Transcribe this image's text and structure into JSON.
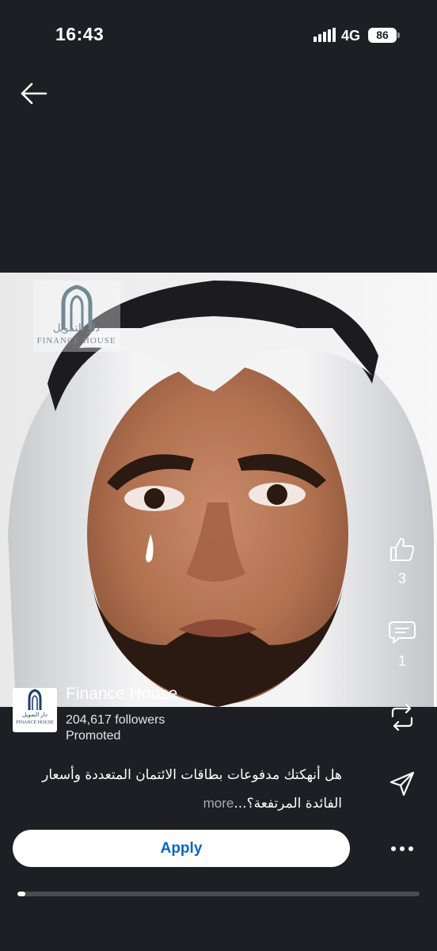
{
  "status_bar": {
    "time": "16:43",
    "network": "4G",
    "battery": "86"
  },
  "media": {
    "description_icon": "crying-man-photo",
    "watermark": {
      "arabic": "دار التمويل",
      "english": "FINANCE HOUSE"
    }
  },
  "actions": {
    "like_count": "3",
    "comment_count": "1"
  },
  "sponsor": {
    "name": "Finance House",
    "followers": "204,617 followers",
    "label": "Promoted",
    "logo_arabic": "دار التمويل",
    "logo_english": "FINANCE HOUSE"
  },
  "caption": {
    "line1": "هل أنهكتك مدفوعات بطاقات الائتمان المتعددة وأسعار",
    "line2": "الفائدة المرتفعة؟...",
    "more": "more"
  },
  "cta": {
    "apply_label": "Apply"
  },
  "progress": {
    "value": 0.02
  },
  "colors": {
    "background": "#1e1f24",
    "accent": "#0a66c2",
    "text": "#ffffff"
  }
}
